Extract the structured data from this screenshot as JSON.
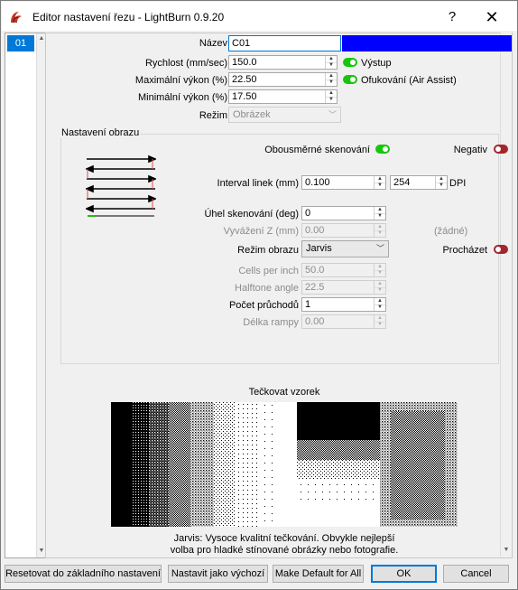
{
  "window": {
    "title": "Editor nastavení řezu - LightBurn 0.9.20",
    "help": "?",
    "close": "✕"
  },
  "layers": {
    "items": [
      {
        "label": "01"
      }
    ]
  },
  "fields": {
    "name_label": "Název",
    "name_value": "C01",
    "layer_color": "#0000ff",
    "speed_label": "Rychlost (mm/sec)",
    "speed_value": "150.0",
    "maxpower_label": "Maximální výkon (%)",
    "maxpower_value": "22.50",
    "minpower_label": "Minimální výkon (%)",
    "minpower_value": "17.50",
    "mode_label": "Režim",
    "mode_value": "Obrázek",
    "output_label": "Výstup",
    "output_on": true,
    "airassist_label": "Ofukování (Air Assist)",
    "airassist_on": true
  },
  "image_settings": {
    "group_title": "Nastavení obrazu",
    "bidir_label": "Obousměrné skenování",
    "bidir_on": true,
    "negative_label": "Negativ",
    "negative_on": false,
    "interval_label": "Interval linek (mm)",
    "interval_value": "0.100",
    "dpi_value": "254",
    "dpi_label": "DPI",
    "angle_label": "Úhel skenování (deg)",
    "angle_value": "0",
    "zoffset_label": "Vyvážení Z (mm)",
    "zoffset_value": "0.00",
    "zoffset_note": "(žádné)",
    "imagemode_label": "Režim obrazu",
    "imagemode_value": "Jarvis",
    "passthrough_label": "Procházet",
    "passthrough_on": false,
    "cpi_label": "Cells per inch",
    "cpi_value": "50.0",
    "halftone_label": "Halftone angle",
    "halftone_value": "22.5",
    "passes_label": "Počet průchodů",
    "passes_value": "1",
    "ramp_label": "Délka rampy",
    "ramp_value": "0.00"
  },
  "preview": {
    "title": "Tečkovat vzorek",
    "desc_line1": "Jarvis: Vysoce kvalitní tečkování. Obvykle nejlepší",
    "desc_line2": "volba pro hladké stínované obrázky nebo fotografie."
  },
  "buttons": {
    "reset": "Resetovat do základního nastavení",
    "set_default": "Nastavit jako výchozí",
    "make_default_all": "Make Default for All",
    "ok": "OK",
    "cancel": "Cancel"
  },
  "colors": {
    "toggle_on": "#16c60c",
    "toggle_off": "#a4262c",
    "selection": "#0078d7"
  }
}
